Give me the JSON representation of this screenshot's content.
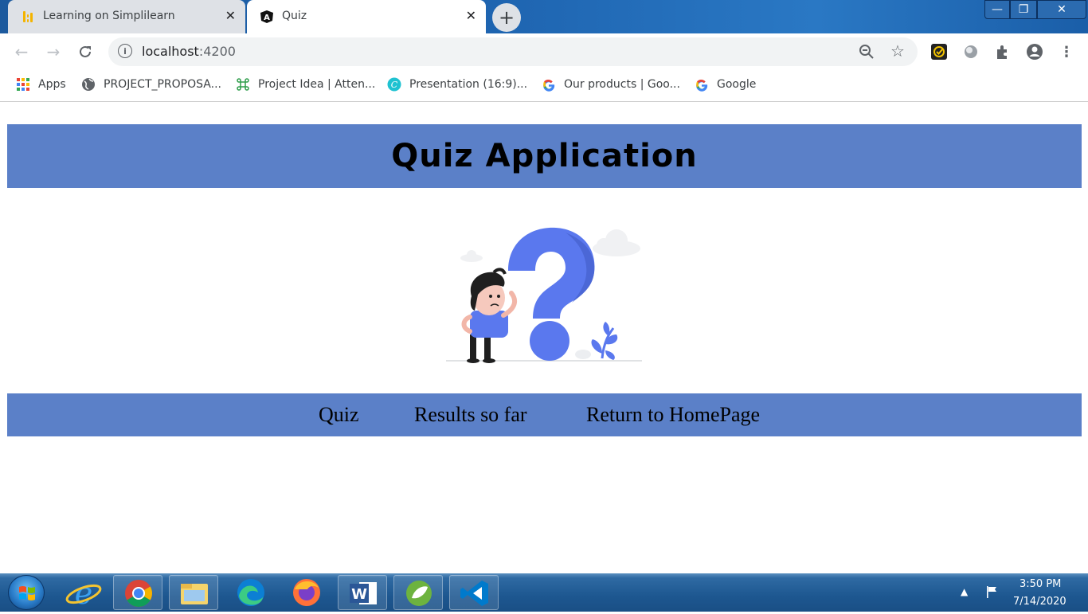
{
  "browser": {
    "tabs": [
      {
        "title": "Learning on Simplilearn",
        "favicon": "simplilearn-icon",
        "active": false
      },
      {
        "title": "Quiz",
        "favicon": "angular-icon",
        "active": true
      }
    ],
    "new_tab_glyph": "+",
    "close_glyph": "✕",
    "window_controls": {
      "min": "—",
      "max": "❐",
      "close": "✕"
    },
    "address": {
      "host": "localhost",
      "port": ":4200"
    },
    "bookmarks": [
      {
        "label": "Apps",
        "icon": "apps-grid-icon"
      },
      {
        "label": "PROJECT_PROPOSA...",
        "icon": "globe-icon"
      },
      {
        "label": "Project Idea | Atten...",
        "icon": "command-icon"
      },
      {
        "label": "Presentation (16:9)...",
        "icon": "canva-icon"
      },
      {
        "label": "Our products | Goo...",
        "icon": "google-icon"
      },
      {
        "label": "Google",
        "icon": "google-icon"
      }
    ]
  },
  "page": {
    "heading": "Quiz Application",
    "illustration": "confused-person-question-mark",
    "nav": [
      {
        "label": "Quiz"
      },
      {
        "label": "Results so far"
      },
      {
        "label": "Return to HomePage"
      }
    ],
    "colors": {
      "bar": "#5b80c8",
      "accent": "#5a78ee"
    }
  },
  "taskbar": {
    "pinned": [
      "ie-icon",
      "chrome-icon",
      "file-explorer-icon",
      "edge-icon",
      "firefox-icon",
      "word-icon",
      "spring-icon",
      "vscode-icon"
    ],
    "clock": {
      "time": "3:50 PM",
      "date": "7/14/2020"
    }
  }
}
